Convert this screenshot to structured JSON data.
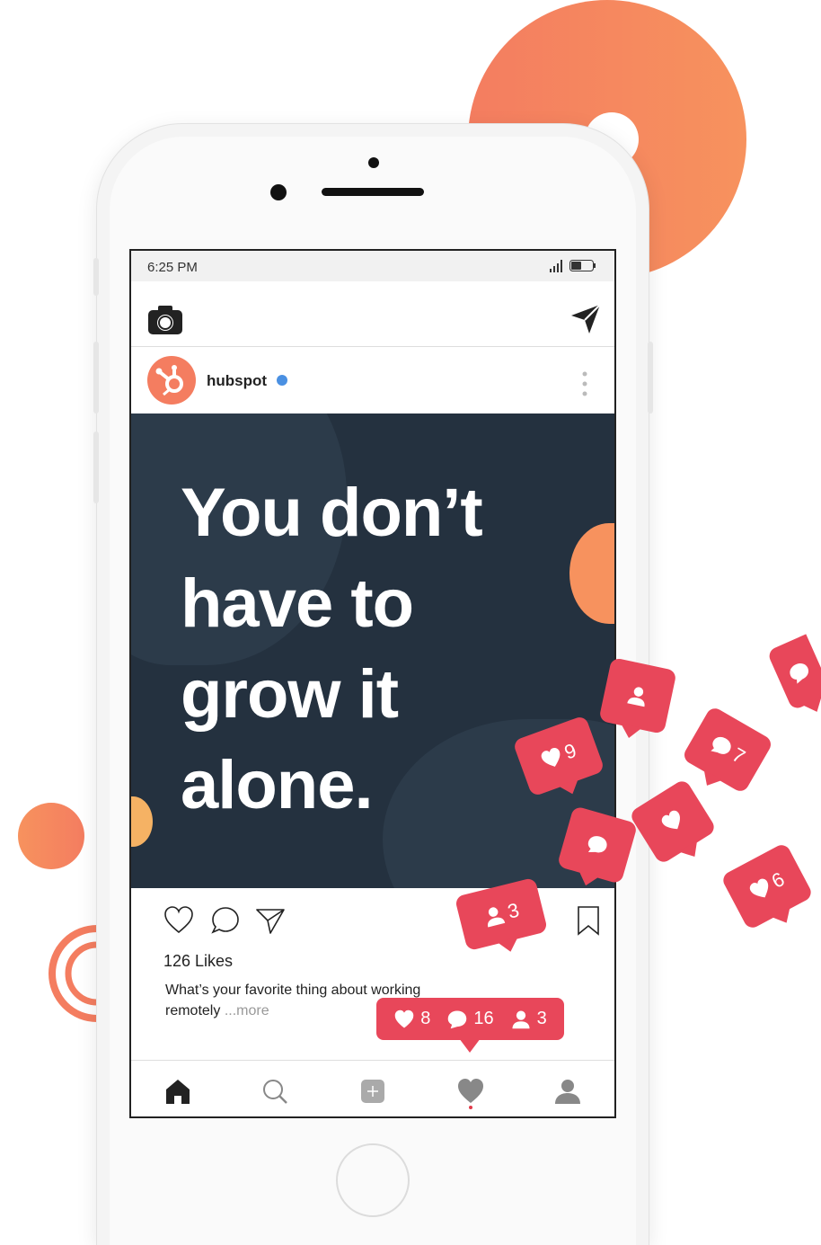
{
  "status_bar": {
    "time": "6:25 PM"
  },
  "post": {
    "username": "hubspot",
    "headline_lines": [
      "You don’t",
      "have to",
      "grow it",
      "alone."
    ],
    "likes": "126 Likes",
    "caption_text": "What’s your favorite thing about working remotely",
    "caption_more": "...more"
  },
  "notification_bubbles": {
    "likes_9": "9",
    "comments_7": "7",
    "likes_6": "6",
    "followers_3": "3"
  },
  "activity_summary": {
    "likes": "8",
    "comments": "16",
    "followers": "3"
  },
  "bottom_nav": [
    "home-icon",
    "search-icon",
    "add-icon",
    "activity-heart-icon",
    "profile-icon"
  ],
  "colors": {
    "accent_orange": "#f47d60",
    "notification_red": "#e8475a",
    "post_background": "#24313f",
    "verified_blue": "#4a90e2"
  }
}
